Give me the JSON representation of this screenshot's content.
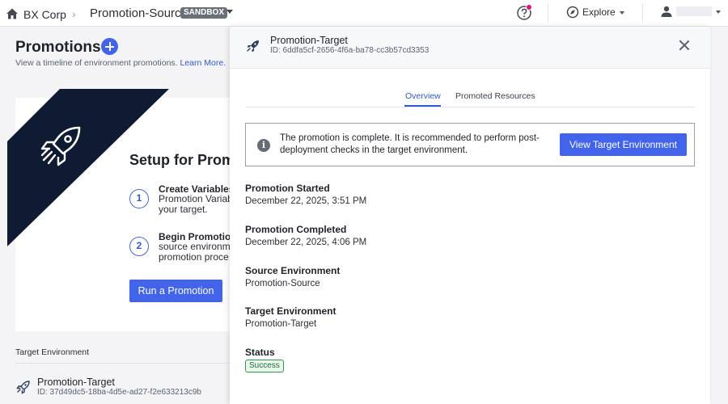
{
  "topbar": {
    "org": "BX Corp",
    "separator": "›",
    "environment": "Promotion-Source",
    "env_badge": "SANDBOX",
    "explore_label": "Explore"
  },
  "page": {
    "title": "Promotions",
    "subtitle": "View a timeline of environment promotions.",
    "learn_more": "Learn More."
  },
  "setup": {
    "title": "Setup for Prom",
    "steps": [
      {
        "number": "1",
        "title": "Create Variables",
        "desc_line1": "Promotion Variab",
        "desc_line2": "your target."
      },
      {
        "number": "2",
        "title": "Begin Promotion",
        "desc_line1": "source environm",
        "desc_line2": "promotion proce"
      }
    ],
    "run_button": "Run a Promotion"
  },
  "target_list": {
    "label": "Target Environment",
    "items": [
      {
        "name": "Promotion-Target",
        "id": "ID: 37d49dc5-18ba-4d5e-ad27-f2e633213c9b"
      }
    ]
  },
  "panel": {
    "title": "Promotion-Target",
    "id": "ID: 6ddfa5cf-2656-4f6a-ba78-cc3b57cd3353",
    "tabs": [
      {
        "label": "Overview",
        "active": true
      },
      {
        "label": "Promoted Resources",
        "active": false
      }
    ],
    "alert": {
      "text": "The promotion is complete. It is recommended to perform post-deployment checks in the target environment.",
      "button": "View Target Environment"
    },
    "fields": [
      {
        "label": "Promotion Started",
        "value": "December 22, 2025, 3:51 PM"
      },
      {
        "label": "Promotion Completed",
        "value": "December 22, 2025, 4:06 PM"
      },
      {
        "label": "Source Environment",
        "value": "Promotion-Source"
      },
      {
        "label": "Target Environment",
        "value": "Promotion-Target"
      }
    ],
    "status_label": "Status",
    "status_value": "Success"
  },
  "colors": {
    "accent": "#4264ea",
    "banner": "#0f1b33",
    "success_border": "#2a9c4a",
    "notification": "#e0127a"
  },
  "icons": [
    "home-icon",
    "help-icon",
    "compass-icon",
    "user-icon",
    "rocket-icon",
    "close-icon",
    "info-icon",
    "plus-icon"
  ]
}
